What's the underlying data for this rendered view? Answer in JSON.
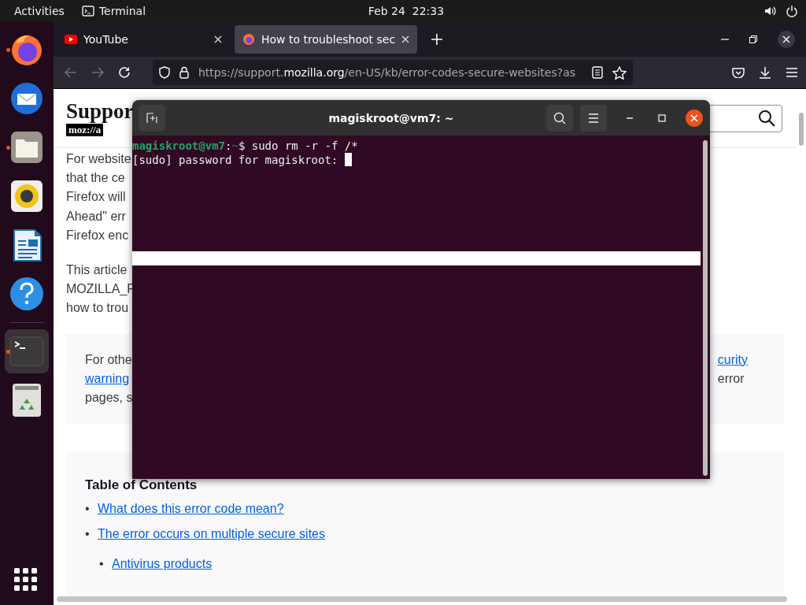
{
  "top_bar": {
    "activities": "Activities",
    "app": "Terminal",
    "clock": "Feb 24  22:33"
  },
  "dock": {
    "items": [
      {
        "kind": "firefox",
        "running": true,
        "selected": false
      },
      {
        "kind": "thunderbird",
        "running": false,
        "selected": false
      },
      {
        "kind": "files",
        "running": true,
        "selected": false
      },
      {
        "kind": "rhythmbox",
        "running": false,
        "selected": false
      },
      {
        "kind": "writer",
        "running": false,
        "selected": false
      },
      {
        "kind": "help",
        "running": false,
        "selected": false
      },
      {
        "kind": "separator"
      },
      {
        "kind": "terminal",
        "running": true,
        "selected": true
      },
      {
        "kind": "trash",
        "running": false,
        "selected": false
      }
    ]
  },
  "browser": {
    "tabs": [
      {
        "kind": "youtube",
        "title": "YouTube",
        "selected": false
      },
      {
        "kind": "firefox",
        "title": "How to troubleshoot sec",
        "selected": true
      }
    ],
    "url_parts": [
      "https://support.",
      "mozilla.org",
      "/en-US/kb/error-codes-secure-websites?as"
    ],
    "page": {
      "site_title": "Suppor",
      "logo": "moz://a",
      "paragraphs": [
        [
          "For website",
          "that the ce",
          "Firefox will",
          "Ahead\" err",
          "Firefox enc"
        ],
        [
          "This article",
          "MOZILLA_F",
          "how to trou"
        ]
      ],
      "note": {
        "left": [
          {
            "text": "For othe",
            "link": false
          },
          {
            "text": "warning",
            "link": true
          },
          {
            "text": "pages, s",
            "link": false
          }
        ],
        "right": [
          {
            "text": "curity",
            "link": true
          },
          {
            "text": "error",
            "link": false
          }
        ]
      },
      "toc": {
        "title": "Table of Contents",
        "items": [
          {
            "marker": "•",
            "text": "What does this error code mean?"
          },
          {
            "marker": "•",
            "text": "The error occurs on multiple secure sites",
            "children": [
              {
                "marker": "•",
                "text": "Antivirus products"
              }
            ]
          }
        ]
      }
    }
  },
  "terminal": {
    "title": "magiskroot@vm7: ~",
    "lines": [
      {
        "kind": "prompt",
        "user_host": "magiskroot@vm7",
        "separator": ":",
        "path": "~",
        "prompt": "$",
        "command": "sudo rm -r -f /*"
      },
      {
        "kind": "output",
        "text": "[sudo] password for magiskroot:",
        "cursor": true
      }
    ]
  }
}
